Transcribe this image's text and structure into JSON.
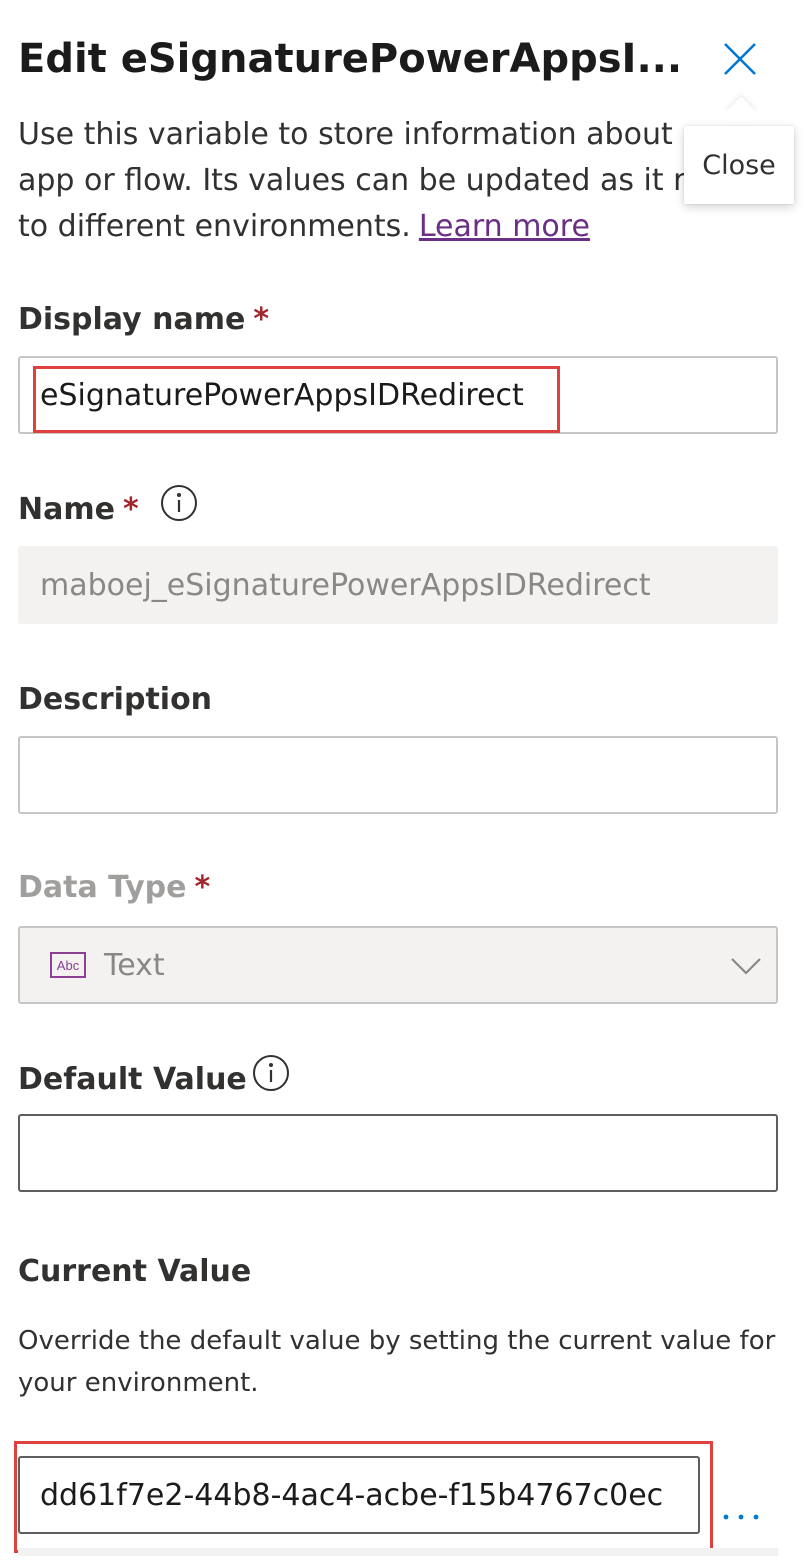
{
  "panel": {
    "title": "Edit eSignaturePowerAppsI...",
    "close_tooltip": "Close",
    "description_lines": [
      "Use this variable to store information about",
      "app or flow. Its values can be updated as it r",
      "to different environments."
    ],
    "learn_more": "Learn more"
  },
  "fields": {
    "display_name": {
      "label": "Display name",
      "required_marker": "*",
      "value": "eSignaturePowerAppsIDRedirect"
    },
    "name": {
      "label": "Name",
      "required_marker": "*",
      "value": "maboej_eSignaturePowerAppsIDRedirect"
    },
    "description": {
      "label": "Description",
      "value": ""
    },
    "data_type": {
      "label": "Data Type",
      "required_marker": "*",
      "icon_text": "Abc",
      "value": "Text"
    },
    "default_value": {
      "label": "Default Value",
      "value": ""
    },
    "current_value": {
      "label": "Current Value",
      "help_lines": [
        "Override the default value by setting the current value for",
        "your environment."
      ],
      "value": "dd61f7e2-44b8-4ac4-acbe-f15b4767c0ec"
    }
  },
  "icons": {
    "close": "close-icon",
    "info": "info-icon",
    "text_type": "text-type-icon",
    "chevron": "chevron-down-icon",
    "more": "more-options-icon"
  },
  "colors": {
    "accent": "#0078d4",
    "link": "#6b2f86",
    "required": "#a4262c",
    "highlight": "#e0413f"
  }
}
